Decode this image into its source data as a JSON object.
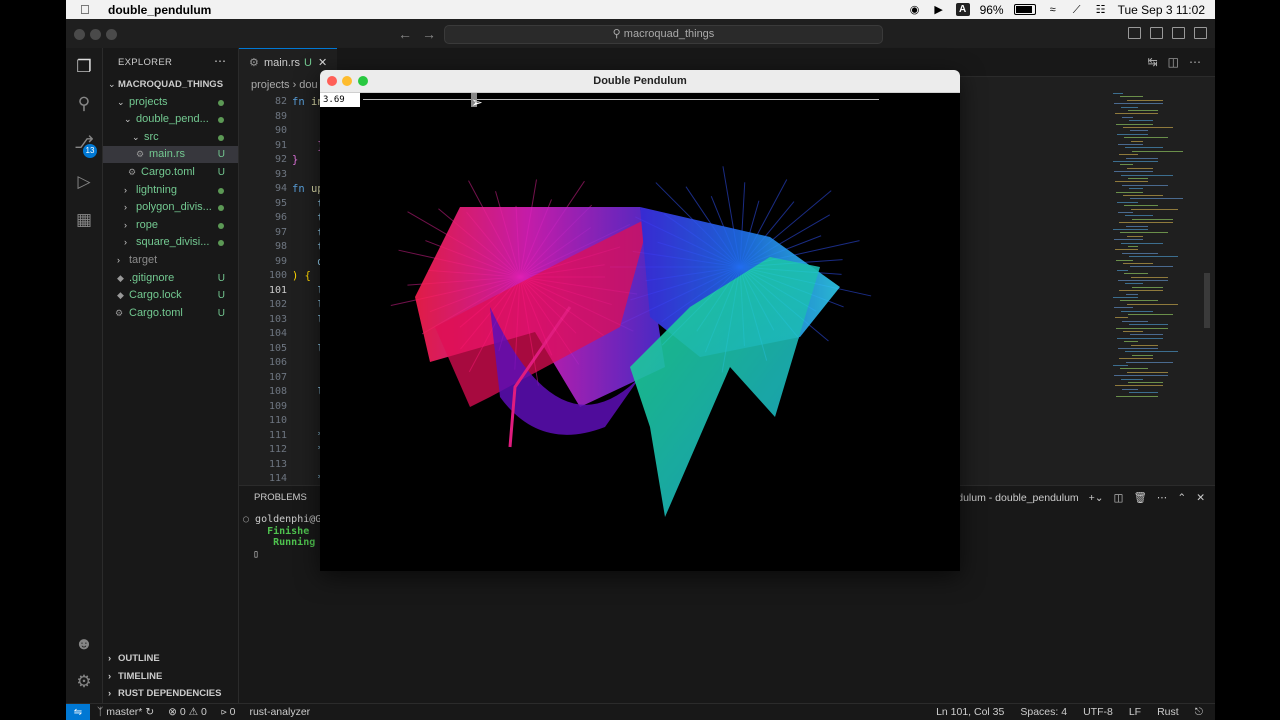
{
  "menubar": {
    "app_name": "double_pendulum",
    "battery": "96%",
    "input_source": "A",
    "datetime": "Tue Sep 3  11:02"
  },
  "titlebar": {
    "search_text": "macroquad_things"
  },
  "activitybar": {
    "scm_badge": "13"
  },
  "sidebar": {
    "title": "EXPLORER",
    "root": "MACROQUAD_THINGS",
    "items": [
      {
        "label": "projects",
        "status": "dot"
      },
      {
        "label": "double_pend...",
        "status": "dot"
      },
      {
        "label": "src",
        "status": "dot"
      },
      {
        "label": "main.rs",
        "status": "U"
      },
      {
        "label": "Cargo.toml",
        "status": "U"
      },
      {
        "label": "lightning",
        "status": "dot"
      },
      {
        "label": "polygon_divis...",
        "status": "dot"
      },
      {
        "label": "rope",
        "status": "dot"
      },
      {
        "label": "square_divisi...",
        "status": "dot"
      },
      {
        "label": "target",
        "status": ""
      },
      {
        "label": ".gitignore",
        "status": "U"
      },
      {
        "label": "Cargo.lock",
        "status": "U"
      },
      {
        "label": "Cargo.toml",
        "status": "U"
      }
    ],
    "sections": [
      "OUTLINE",
      "TIMELINE",
      "RUST DEPENDENCIES"
    ]
  },
  "editor": {
    "tab_label": "main.rs",
    "tab_status": "U",
    "breadcrumb": "projects › dou",
    "line_numbers": [
      "82",
      "89",
      "90",
      "91",
      "92",
      "93",
      "94",
      "95",
      "96",
      "97",
      "98",
      "99",
      "100",
      "101",
      "102",
      "103",
      "104",
      "105",
      "106",
      "107",
      "108",
      "109",
      "110",
      "111",
      "112",
      "113",
      "114"
    ],
    "code_lines": [
      "fn in",
      "",
      "",
      "    }",
      "}",
      "",
      "fn up",
      "    t",
      "    t",
      "    t",
      "    t",
      "    d",
      ") {",
      "    l",
      "    l",
      "    l",
      "",
      "    l",
      "",
      "",
      "    l",
      "",
      "",
      "    *",
      "    *",
      "",
      "    *"
    ]
  },
  "panel": {
    "title": "PROBLEMS",
    "terminal_name": "dulum - double_pendulum",
    "terminal_lines": [
      "goldenphi@Go",
      "    Finishe",
      "     Running",
      "▯"
    ]
  },
  "statusbar": {
    "branch": "master*",
    "errors": "0",
    "warnings": "0",
    "ports": "0",
    "analyzer": "rust-analyzer",
    "position": "Ln 101, Col 35",
    "spaces": "Spaces: 4",
    "encoding": "UTF-8",
    "eol": "LF",
    "language": "Rust"
  },
  "pendulum_window": {
    "title": "Double Pendulum",
    "slider_value": "3.69",
    "slider_fraction": 0.21
  }
}
